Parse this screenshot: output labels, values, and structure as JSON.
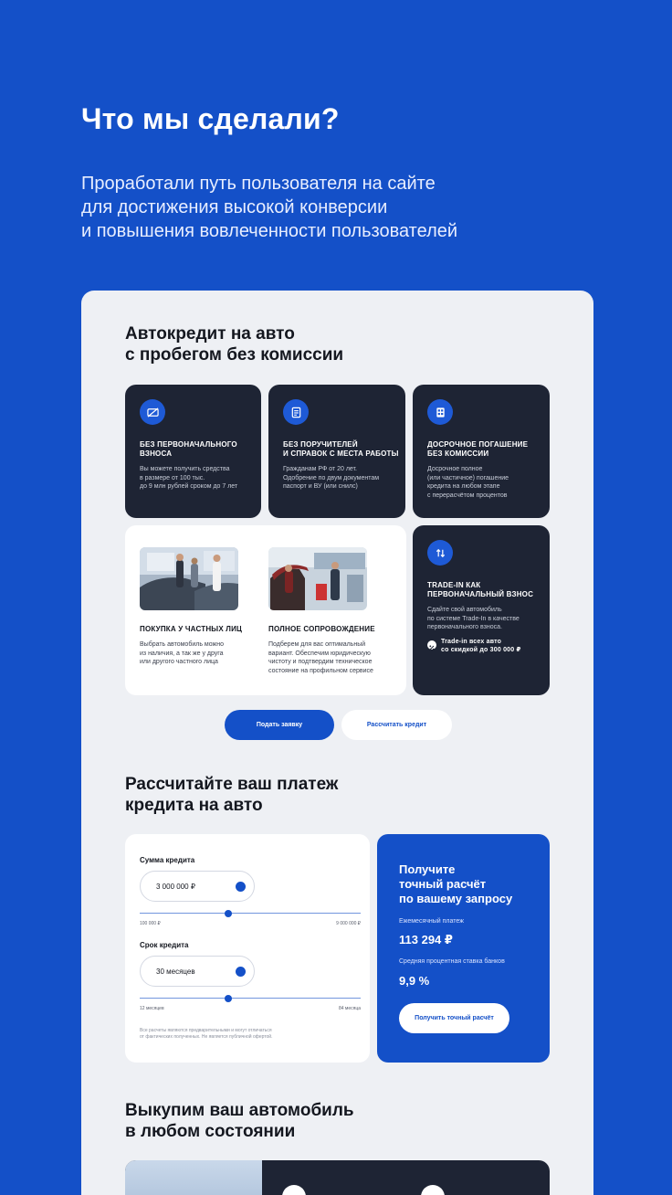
{
  "hero": {
    "title": "Что мы сделали?",
    "subtitle": [
      "Проработали путь пользователя на сайте",
      "для достижения высокой конверсии",
      "и повышения вовлеченности пользователей"
    ]
  },
  "credit_section": {
    "title": [
      "Автокредит на авто",
      "с пробегом без комиссии"
    ],
    "features": [
      {
        "icon": "no-payment-icon",
        "title": [
          "БЕЗ ПЕРВОНАЧАЛЬНОГО",
          "ВЗНОСА"
        ],
        "text": [
          "Вы можете получить средства",
          "в размере от 100 тыс.",
          "до 9 млн рублей сроком до 7 лет"
        ]
      },
      {
        "icon": "document-icon",
        "title": [
          "БЕЗ ПОРУЧИТЕЛЕЙ",
          "И СПРАВОК С МЕСТА РАБОТЫ"
        ],
        "text": [
          "Гражданам РФ от 20 лет.",
          "Одобрение по двум документам",
          "паспорт и ВУ (или снилс)"
        ]
      },
      {
        "icon": "calculator-icon",
        "title": [
          "ДОСРОЧНОЕ ПОГАШЕНИЕ",
          "БЕЗ КОМИССИИ"
        ],
        "text": [
          "Досрочное полное",
          "(или частичное) погашение",
          "кредита на любом этапе",
          "с перерасчётом процентов"
        ]
      }
    ],
    "photo_features": [
      {
        "image": "car-buyers-photo",
        "title": "ПОКУПКА У ЧАСТНЫХ ЛИЦ",
        "text": [
          "Выбрать автомобиль можно",
          "из наличия, а так же у друга",
          "или другого частного лица"
        ]
      },
      {
        "image": "car-service-photo",
        "title": "ПОЛНОЕ СОПРОВОЖДЕНИЕ",
        "text": [
          "Подберем для вас оптимальный",
          "вариант. Обеспечим юридическую",
          "чистоту и подтвердим техническое",
          "состояние на профильном сервисе"
        ]
      }
    ],
    "trade_in": {
      "icon": "swap-arrows-icon",
      "title": [
        "TRADE-IN КАК",
        "ПЕРВОНАЧАЛЬНЫЙ ВЗНОС"
      ],
      "text": [
        "Сдайте свой автомобиль",
        "по системе Trade-In в качестве",
        "первоначального взноса."
      ],
      "promo_icon": "percent-icon",
      "promo": [
        "Trade-in всех авто",
        "со скидкой до 300 000 ₽"
      ]
    },
    "buttons": {
      "apply": "Подать заявку",
      "calculate": "Рассчитать кредит"
    }
  },
  "calculator": {
    "title": [
      "Рассчитайте ваш платеж",
      "кредита на авто"
    ],
    "amount": {
      "label": "Сумма кредита",
      "value": "3 000 000 ₽",
      "min": "100 000 ₽",
      "max": "9 000 000 ₽",
      "slider_fraction": 0.4
    },
    "term": {
      "label": "Срок кредита",
      "value": "30 месяцев",
      "min": "12 месяцев",
      "max": "84 месяца",
      "slider_fraction": 0.4
    },
    "disclaimer": [
      "Все расчеты являются предварительными и могут отличаться",
      "от фактических полученных. Не является публичной офертой."
    ],
    "offer": {
      "title": [
        "Получите",
        "точный расчёт",
        "по вашему запросу"
      ],
      "monthly_label": "Ежемесячный платеж",
      "monthly_value": "113 294 ₽",
      "rate_label": "Средняя процентная ставка банков",
      "rate_value": "9,9 %",
      "button": "Получить точный расчёт"
    }
  },
  "buyout": {
    "title": [
      "Выкупим ваш автомобиль",
      "в любом состоянии"
    ]
  },
  "colors": {
    "brand_blue": "#1450c8",
    "dark_card": "#1e2434",
    "panel_bg": "#eef0f4"
  }
}
